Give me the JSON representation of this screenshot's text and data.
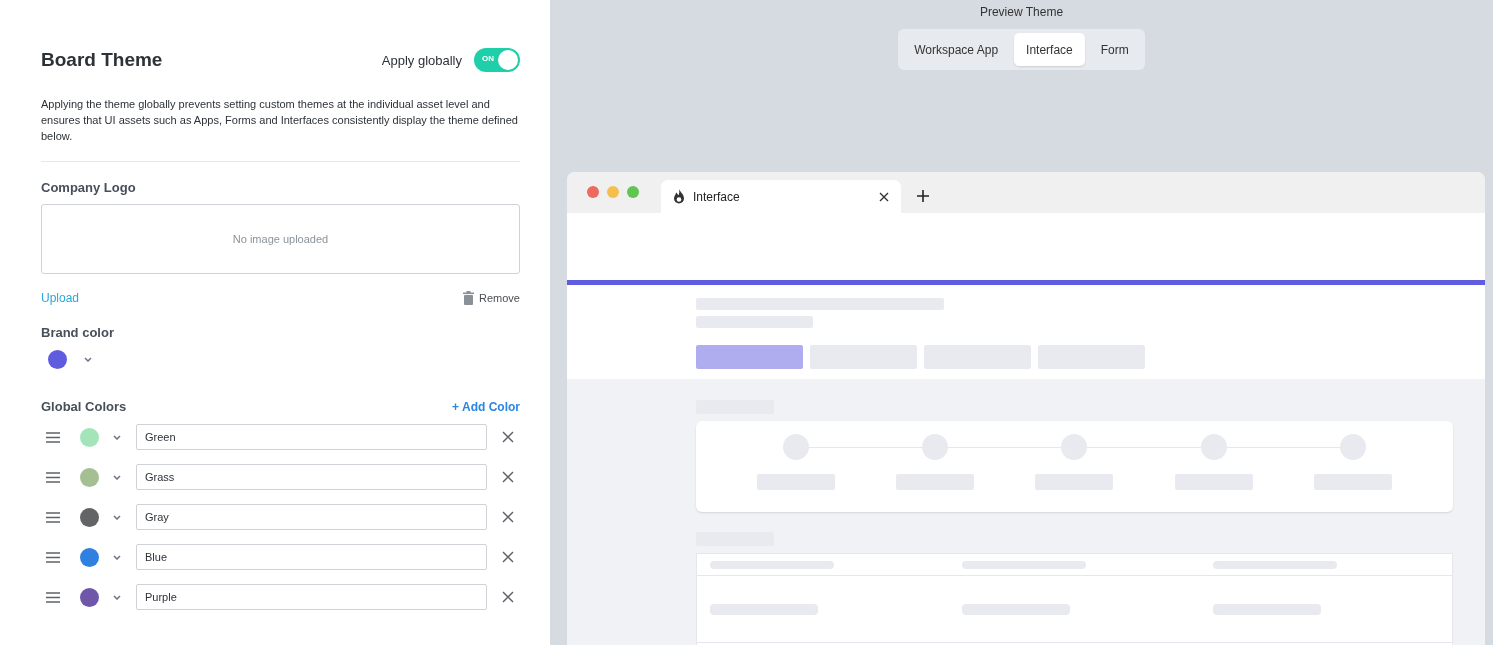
{
  "panel": {
    "title": "Board Theme",
    "apply_globally": {
      "label": "Apply globally",
      "on": true,
      "on_text": "ON"
    },
    "description": "Applying the theme globally prevents setting custom themes at the individual asset level and ensures that UI assets such as Apps, Forms and Interfaces consistently display the theme defined below.",
    "logo": {
      "label": "Company Logo",
      "empty_text": "No image uploaded",
      "upload": "Upload",
      "remove": "Remove"
    },
    "brand": {
      "label": "Brand color",
      "color": "#5f5ce0"
    },
    "global_colors": {
      "label": "Global Colors",
      "add": "+ Add Color",
      "items": [
        {
          "name": "Green",
          "color": "#a3e4b8"
        },
        {
          "name": "Grass",
          "color": "#a4c093"
        },
        {
          "name": "Gray",
          "color": "#636466"
        },
        {
          "name": "Blue",
          "color": "#2f80e0"
        },
        {
          "name": "Purple",
          "color": "#6e57a8"
        }
      ]
    }
  },
  "preview": {
    "title": "Preview Theme",
    "tabs": [
      {
        "label": "Workspace App",
        "selected": false
      },
      {
        "label": "Interface",
        "selected": true
      },
      {
        "label": "Form",
        "selected": false
      }
    ],
    "browser_tab": {
      "title": "Interface"
    }
  }
}
